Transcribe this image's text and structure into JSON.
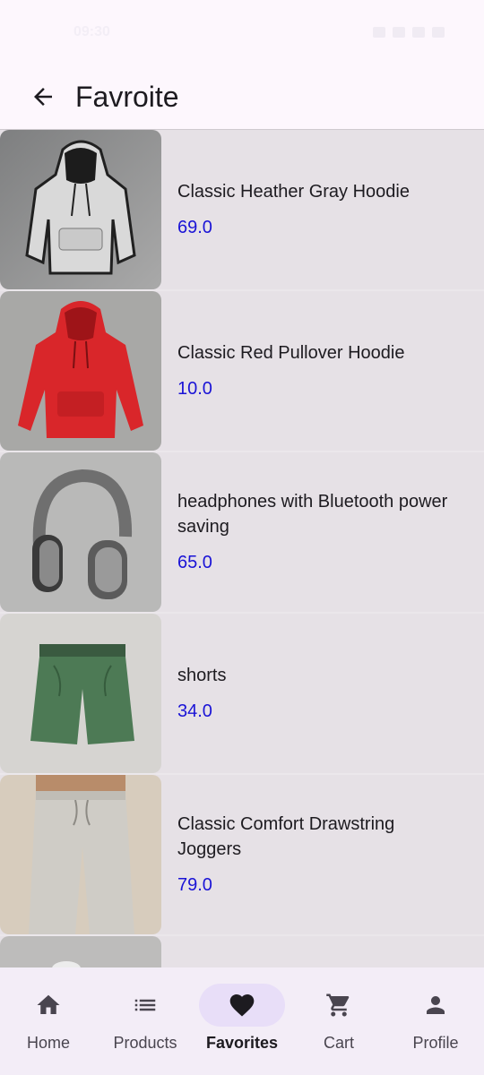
{
  "status_bar": {
    "time": "09:30"
  },
  "app_bar": {
    "title": "Favroite"
  },
  "favorites": [
    {
      "name": "Classic Heather Gray Hoodie",
      "price": "69.0"
    },
    {
      "name": "Classic Red Pullover Hoodie",
      "price": "10.0"
    },
    {
      "name": "headphones with Bluetooth power saving",
      "price": "65.0"
    },
    {
      "name": "shorts",
      "price": "34.0"
    },
    {
      "name": "Classic Comfort Drawstring Joggers",
      "price": "79.0"
    }
  ],
  "bottom_nav": {
    "items": [
      {
        "label": "Home",
        "icon": "home-icon"
      },
      {
        "label": "Products",
        "icon": "list-icon"
      },
      {
        "label": "Favorites",
        "icon": "heart-icon"
      },
      {
        "label": "Cart",
        "icon": "cart-icon"
      },
      {
        "label": "Profile",
        "icon": "person-icon"
      }
    ],
    "active": "Favorites"
  },
  "colors": {
    "accent": "#e8def8",
    "price": "#1a13d6",
    "row_bg": "#e6e1e6",
    "nav_bg": "#f3edf7"
  }
}
